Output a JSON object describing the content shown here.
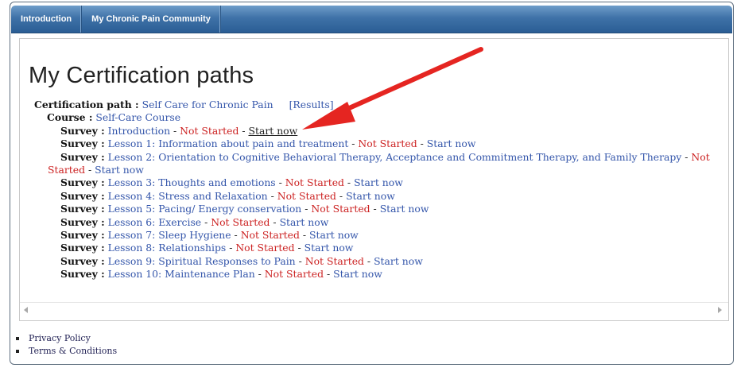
{
  "nav": {
    "tabs": [
      "Introduction",
      "My Chronic Pain Community"
    ]
  },
  "page": {
    "title": "My Certification paths"
  },
  "certification": {
    "label": "Certification path :",
    "name": "Self Care for Chronic Pain",
    "results_link": "[Results]",
    "course": {
      "label": "Course :",
      "name": "Self-Care Course"
    },
    "surveys": [
      {
        "label": "Survey :",
        "title": "Introduction",
        "sep1": " - ",
        "status": "Not Started",
        "sep2": " - ",
        "action": "Start now"
      },
      {
        "label": "Survey :",
        "title": "Lesson 1: Information about pain and treatment",
        "sep1": " - ",
        "status": "Not Started",
        "sep2": " - ",
        "action": "Start now"
      },
      {
        "label": "Survey :",
        "title": "Lesson 2: Orientation to Cognitive Behavioral Therapy, Acceptance and Commitment Therapy, and Family Therapy",
        "sep1": " - ",
        "status": "Not Started",
        "sep2": " - ",
        "action": "Start now"
      },
      {
        "label": "Survey :",
        "title": "Lesson 3: Thoughts and emotions",
        "sep1": " - ",
        "status": "Not Started",
        "sep2": " - ",
        "action": "Start now"
      },
      {
        "label": "Survey :",
        "title": "Lesson 4: Stress and Relaxation",
        "sep1": " - ",
        "status": "Not Started",
        "sep2": " - ",
        "action": "Start now"
      },
      {
        "label": "Survey :",
        "title": "Lesson 5: Pacing/ Energy conservation",
        "sep1": " - ",
        "status": "Not Started",
        "sep2": " - ",
        "action": "Start now"
      },
      {
        "label": "Survey :",
        "title": "Lesson 6: Exercise",
        "sep1": " - ",
        "status": "Not Started",
        "sep2": " - ",
        "action": "Start now"
      },
      {
        "label": "Survey :",
        "title": "Lesson 7: Sleep Hygiene",
        "sep1": " - ",
        "status": "Not Started",
        "sep2": " - ",
        "action": "Start now"
      },
      {
        "label": "Survey :",
        "title": "Lesson 8: Relationships",
        "sep1": " - ",
        "status": "Not Started",
        "sep2": " - ",
        "action": "Start now"
      },
      {
        "label": "Survey :",
        "title": "Lesson 9: Spiritual Responses to Pain",
        "sep1": " - ",
        "status": "Not Started",
        "sep2": " - ",
        "action": "Start now"
      },
      {
        "label": "Survey :",
        "title": "Lesson 10: Maintenance Plan",
        "sep1": " - ",
        "status": "Not Started",
        "sep2": " - ",
        "action": "Start now"
      }
    ]
  },
  "footer": {
    "links": [
      "Privacy Policy",
      "Terms & Conditions"
    ]
  },
  "colors": {
    "link": "#3355aa",
    "status": "#cc2222",
    "nav_bar": "#3f72a8",
    "annotation_arrow": "#e52521"
  }
}
